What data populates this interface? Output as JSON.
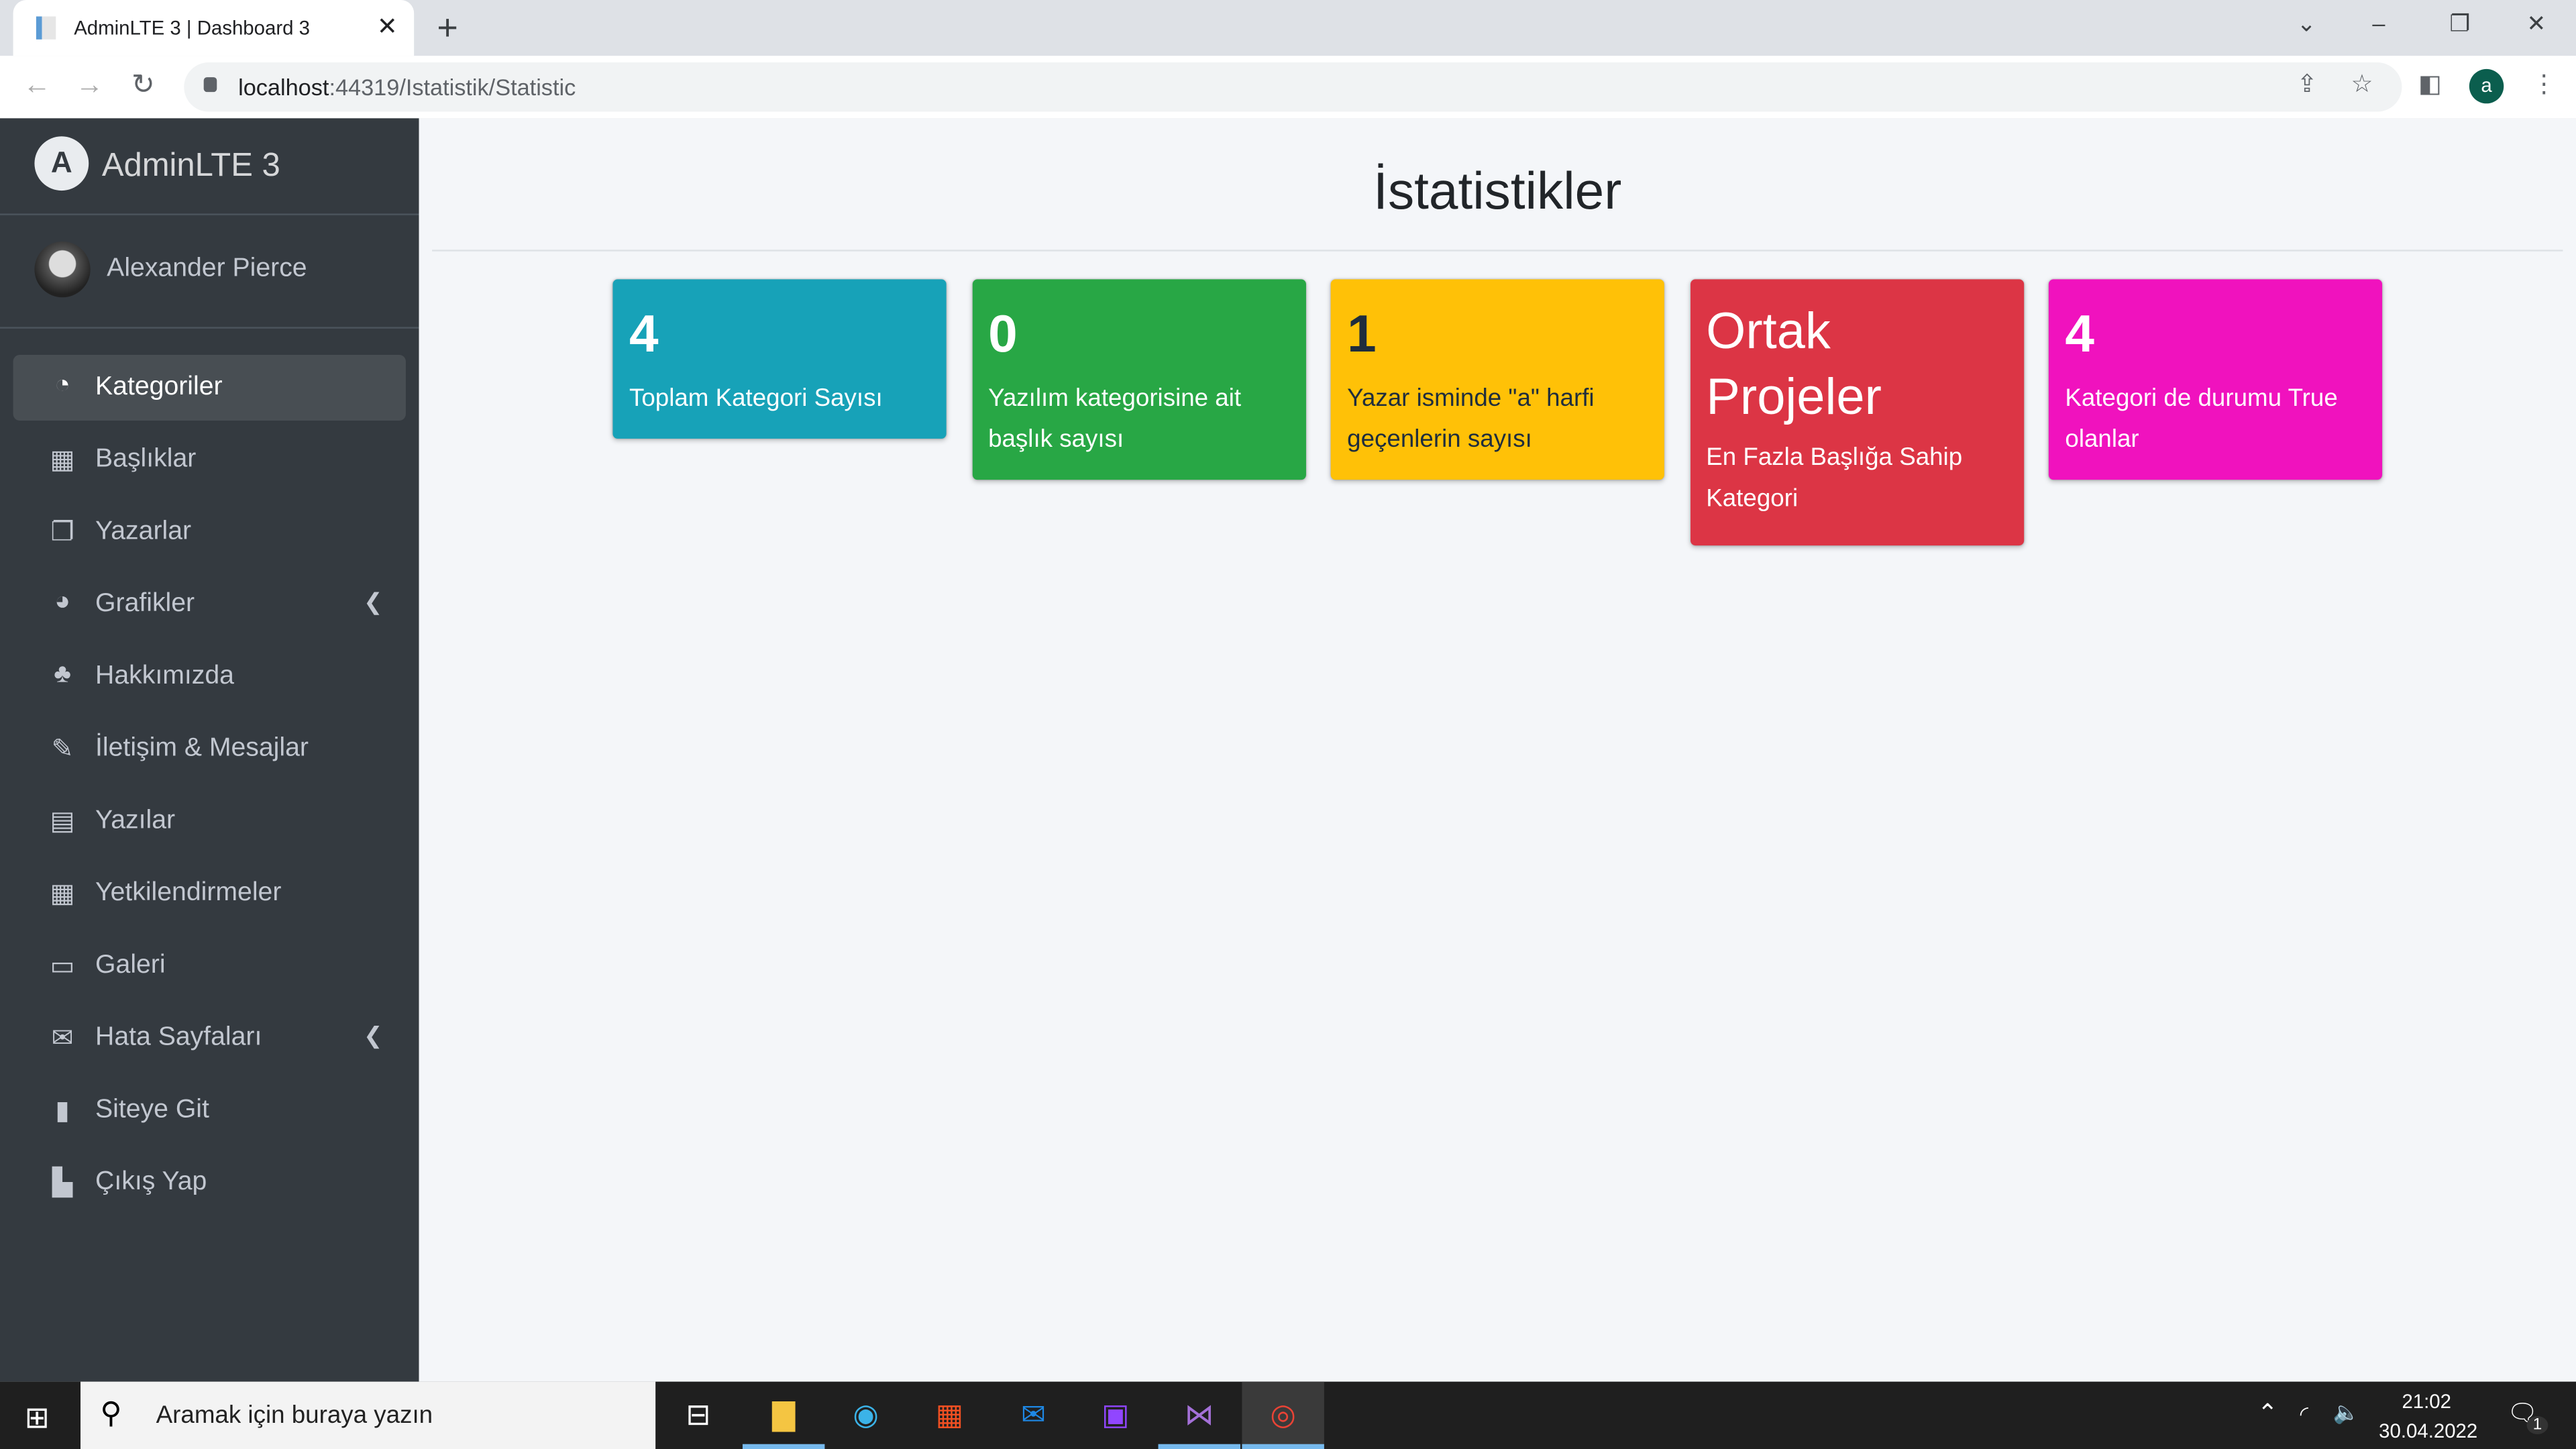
{
  "browser": {
    "tab_title": "AdminLTE 3 | Dashboard 3",
    "url_host": "localhost",
    "url_path": ":44319/Istatistik/Statistic",
    "profile_initial": "a"
  },
  "sidebar": {
    "brand": "AdminLTE 3",
    "user": "Alexander Pierce",
    "items": [
      {
        "label": "Kategoriler",
        "icon": "tachometer-icon"
      },
      {
        "label": "Başlıklar",
        "icon": "grid-icon"
      },
      {
        "label": "Yazarlar",
        "icon": "copy-icon"
      },
      {
        "label": "Grafikler",
        "icon": "pie-chart-icon"
      },
      {
        "label": "Hakkımızda",
        "icon": "tree-icon"
      },
      {
        "label": "İletişim & Mesajlar",
        "icon": "edit-icon"
      },
      {
        "label": "Yazılar",
        "icon": "table-icon"
      },
      {
        "label": "Yetkilendirmeler",
        "icon": "calendar-icon"
      },
      {
        "label": "Galeri",
        "icon": "image-icon"
      },
      {
        "label": "Hata Sayfaları",
        "icon": "envelope-icon"
      },
      {
        "label": "Siteye Git",
        "icon": "book-icon"
      },
      {
        "label": "Çıkış Yap",
        "icon": "door-icon"
      }
    ]
  },
  "main": {
    "title": "İstatistikler",
    "boxes": [
      {
        "value": "4",
        "label": "Toplam Kategori Sayısı",
        "color": "#17a2b8"
      },
      {
        "value": "0",
        "label": "Yazılım kategorisine ait başlık sayısı",
        "color": "#28a745"
      },
      {
        "value": "1",
        "label": "Yazar isminde \"a\" harfi geçenlerin sayısı",
        "color": "#ffc107"
      },
      {
        "value": "Ortak Projeler",
        "label": "En Fazla Başlığa Sahip Kategori",
        "color": "#dc3545"
      },
      {
        "value": "4",
        "label": "Kategori de durumu True olanlar",
        "color": "#f012be"
      }
    ]
  },
  "taskbar": {
    "search_placeholder": "Aramak için buraya yazın",
    "time": "21:02",
    "date": "30.04.2022",
    "notifications": "1"
  }
}
